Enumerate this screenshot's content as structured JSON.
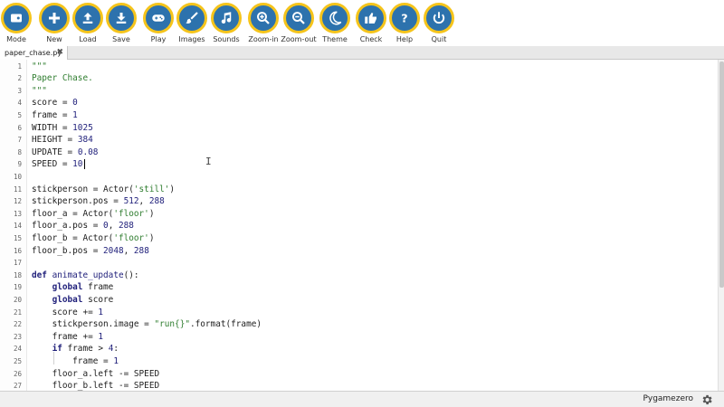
{
  "toolbar": {
    "buttons": [
      {
        "label": "Mode",
        "icon": "mode-icon"
      },
      {
        "label": "New",
        "icon": "plus-icon"
      },
      {
        "label": "Load",
        "icon": "upload-icon"
      },
      {
        "label": "Save",
        "icon": "download-icon"
      },
      {
        "label": "Play",
        "icon": "gamepad-icon"
      },
      {
        "label": "Images",
        "icon": "brush-icon"
      },
      {
        "label": "Sounds",
        "icon": "music-note-icon"
      },
      {
        "label": "Zoom-in",
        "icon": "zoom-in-icon"
      },
      {
        "label": "Zoom-out",
        "icon": "zoom-out-icon"
      },
      {
        "label": "Theme",
        "icon": "moon-icon"
      },
      {
        "label": "Check",
        "icon": "thumbs-up-icon"
      },
      {
        "label": "Help",
        "icon": "question-icon"
      },
      {
        "label": "Quit",
        "icon": "power-icon"
      }
    ],
    "button_color": "#2d72ad",
    "ring_color": "#f5c41b"
  },
  "tab": {
    "filename": "paper_chase.py",
    "close": "✖"
  },
  "editor": {
    "lines": [
      {
        "n": "1",
        "text": "\"\"\"",
        "kind": "string"
      },
      {
        "n": "2",
        "text": "Paper Chase.",
        "kind": "string"
      },
      {
        "n": "3",
        "text": "\"\"\"",
        "kind": "string"
      },
      {
        "n": "4",
        "text": "score = 0",
        "kind": "code"
      },
      {
        "n": "5",
        "text": "frame = 1",
        "kind": "code"
      },
      {
        "n": "6",
        "text": "WIDTH = 1025",
        "kind": "code"
      },
      {
        "n": "7",
        "text": "HEIGHT = 384",
        "kind": "code"
      },
      {
        "n": "8",
        "text": "UPDATE = 0.08",
        "kind": "code"
      },
      {
        "n": "9",
        "text": "SPEED = 10",
        "kind": "code"
      },
      {
        "n": "10",
        "text": "",
        "kind": "code"
      },
      {
        "n": "11",
        "text": "stickperson = Actor('still')",
        "kind": "code"
      },
      {
        "n": "12",
        "text": "stickperson.pos = 512, 288",
        "kind": "code"
      },
      {
        "n": "13",
        "text": "floor_a = Actor('floor')",
        "kind": "code"
      },
      {
        "n": "14",
        "text": "floor_a.pos = 0, 288",
        "kind": "code"
      },
      {
        "n": "15",
        "text": "floor_b = Actor('floor')",
        "kind": "code"
      },
      {
        "n": "16",
        "text": "floor_b.pos = 2048, 288",
        "kind": "code"
      },
      {
        "n": "17",
        "text": "",
        "kind": "code"
      },
      {
        "n": "18",
        "text": "def animate_update():",
        "kind": "code"
      },
      {
        "n": "19",
        "text": "    global frame",
        "kind": "code"
      },
      {
        "n": "20",
        "text": "    global score",
        "kind": "code"
      },
      {
        "n": "21",
        "text": "    score += 1",
        "kind": "code"
      },
      {
        "n": "22",
        "text": "    stickperson.image = \"run{}\".format(frame)",
        "kind": "code"
      },
      {
        "n": "23",
        "text": "    frame += 1",
        "kind": "code"
      },
      {
        "n": "24",
        "text": "    if frame > 4:",
        "kind": "code"
      },
      {
        "n": "25",
        "text": "        frame = 1",
        "kind": "code"
      },
      {
        "n": "26",
        "text": "    floor_a.left -= SPEED",
        "kind": "code"
      },
      {
        "n": "27",
        "text": "    floor_b.left -= SPEED",
        "kind": "code"
      }
    ],
    "colors": {
      "string": "#2f7d2f",
      "keyword": "#1f1f7a",
      "number": "#1f1f7a",
      "text": "#202020"
    }
  },
  "status": {
    "mode": "Pygamezero",
    "settings_icon": "gear-icon"
  }
}
